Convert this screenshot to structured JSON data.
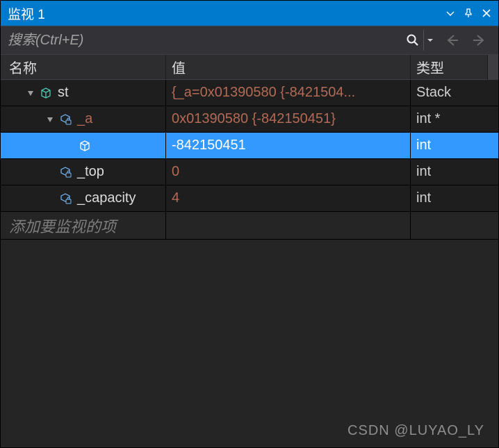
{
  "title": "监视 1",
  "search": {
    "placeholder": "搜索(Ctrl+E)"
  },
  "columns": {
    "name": "名称",
    "value": "值",
    "type": "类型"
  },
  "rows": [
    {
      "indent": 1,
      "expander": "expanded",
      "icon": "object-cube",
      "name": "st",
      "name_color": "#dcdcdc",
      "value": "{_a=0x01390580 {-8421504...",
      "value_color": "#b46a55",
      "type": "Stack",
      "selected": false
    },
    {
      "indent": 2,
      "expander": "expanded",
      "icon": "field-lock",
      "name": "_a",
      "name_color": "#b46a55",
      "value": "0x01390580 {-842150451}",
      "value_color": "#b46a55",
      "type": "int *",
      "selected": false
    },
    {
      "indent": 3,
      "expander": "none",
      "icon": "object-cube",
      "name": "",
      "name_color": "#ffffff",
      "value": "-842150451",
      "value_color": "#ffffff",
      "type": "int",
      "selected": true
    },
    {
      "indent": 2,
      "expander": "none",
      "icon": "field-lock",
      "name": "_top",
      "name_color": "#dcdcdc",
      "value": "0",
      "value_color": "#b46a55",
      "type": "int",
      "selected": false
    },
    {
      "indent": 2,
      "expander": "none",
      "icon": "field-lock",
      "name": "_capacity",
      "name_color": "#dcdcdc",
      "value": "4",
      "value_color": "#b46a55",
      "type": "int",
      "selected": false
    }
  ],
  "add_item_label": "添加要监视的项",
  "watermark": "CSDN @LUYAO_LY"
}
